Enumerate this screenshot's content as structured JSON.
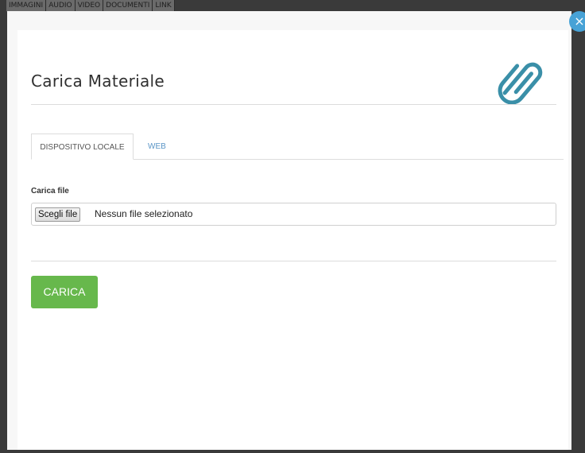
{
  "backdrop": {
    "tabs": [
      "IMMAGINI",
      "AUDIO",
      "VIDEO",
      "DOCUMENTI",
      "LINK"
    ]
  },
  "modal": {
    "title": "Carica Materiale",
    "close_label": "×",
    "tabs": [
      {
        "label": "DISPOSITIVO LOCALE",
        "active": true
      },
      {
        "label": "WEB",
        "active": false
      }
    ],
    "file_field": {
      "label": "Carica file",
      "button_label": "Scegli file",
      "status": "Nessun file selezionato"
    },
    "submit_label": "CARICA"
  },
  "colors": {
    "accent_blue": "#47a2d6",
    "submit_green": "#67b84c",
    "icon_teal": "#3a8fa8"
  },
  "icons": [
    "close-icon",
    "paperclip-icon"
  ]
}
